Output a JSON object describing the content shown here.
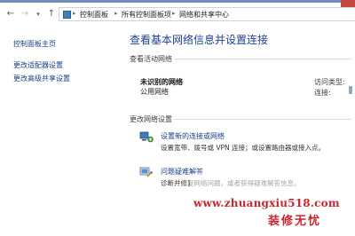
{
  "address_bar": {
    "crumbs": [
      "控制面板",
      "所有控制面板项",
      "网络和共享中心"
    ]
  },
  "nav": {
    "back_icon": "arrow-left-icon",
    "forward_icon": "arrow-right-icon",
    "dropdown_icon": "chevron-down-icon",
    "up_icon": "arrow-up-icon"
  },
  "sidebar": {
    "items": [
      {
        "label": "控制面板主页"
      },
      {
        "label": "更改适配器设置"
      },
      {
        "label": "更改高级共享设置"
      }
    ]
  },
  "main": {
    "title": "查看基本网络信息并设置连接",
    "active_networks_label": "查看活动网络",
    "network": {
      "name": "未识别的网络",
      "type": "公用网络",
      "access_type_label": "访问类型:",
      "connections_label": "连接:"
    },
    "change_settings_label": "更改网络设置",
    "tasks": [
      {
        "icon": "network-setup-icon",
        "link": "设置新的连接或网络",
        "desc": "设置宽带、拨号或 VPN 连接；或设置路由器或接入点。"
      },
      {
        "icon": "troubleshoot-icon",
        "link": "问题疑难解答",
        "desc": "诊断并修复网络问题，或者获得疑难解答信息。"
      }
    ]
  },
  "watermark": {
    "url": "www.zhuangxiu518.com",
    "name": "装修无忧"
  },
  "colors": {
    "link": "#1a3e86",
    "title": "#1e3f92",
    "watermark": "#c9262d"
  }
}
